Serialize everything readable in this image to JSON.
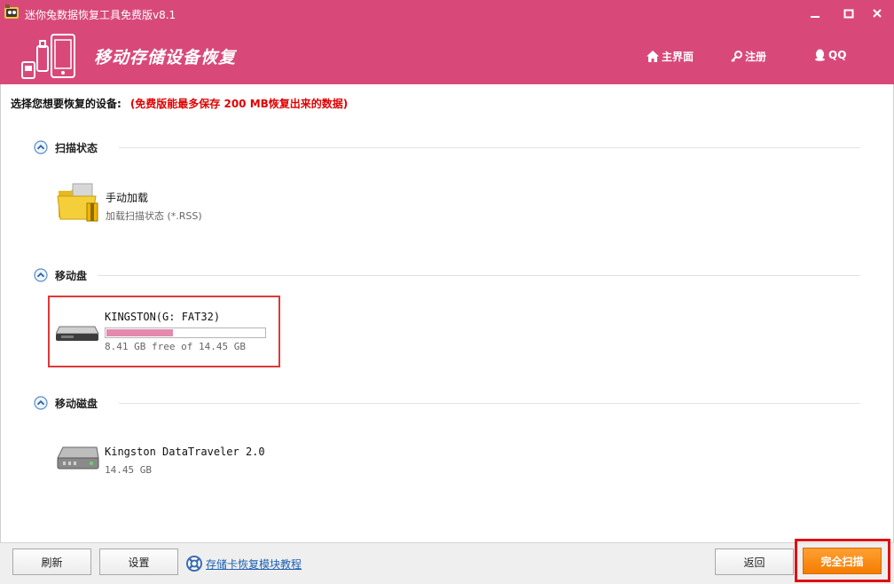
{
  "window": {
    "title": "迷你兔数据恢复工具免费版v8.1"
  },
  "header": {
    "title": "移动存储设备恢复",
    "nav": [
      {
        "label": "主界面",
        "icon": "home-icon"
      },
      {
        "label": "注册",
        "icon": "key-icon"
      },
      {
        "label": "QQ",
        "icon": "qq-penguin-icon"
      }
    ]
  },
  "instruction": {
    "label": "选择您想要恢复的设备:",
    "note": "(免费版能最多保存 200 MB恢复出来的数据)"
  },
  "sections": {
    "scan_state": {
      "title": "扫描状态",
      "item_title": "手动加载",
      "item_subtitle": "加载扫描状态 (*.RSS)"
    },
    "removable": {
      "title": "移动盘",
      "device_name": "KINGSTON(G: FAT32)",
      "device_free": "8.41 GB free of 14.45 GB",
      "used_fraction": 0.418
    },
    "removable_disk": {
      "title": "移动磁盘",
      "device_name": "Kingston DataTraveler 2.0",
      "device_size": "14.45 GB"
    }
  },
  "footer": {
    "refresh": "刷新",
    "settings": "设置",
    "tutorial_link": "存储卡恢复模块教程",
    "back": "返回",
    "full_scan": "完全扫描"
  },
  "colors": {
    "brand": "#d8497a",
    "accent_orange": "#f57c00",
    "link": "#1e5fb3",
    "warning": "#e00000",
    "progress_fill": "#e58aae"
  }
}
